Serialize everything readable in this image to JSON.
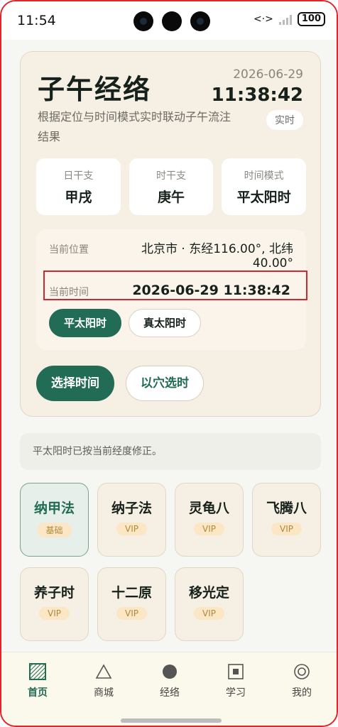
{
  "status_bar": {
    "time": "11:54",
    "battery": "100"
  },
  "header": {
    "title": "子午经络",
    "date": "2026-06-29",
    "clock": "11:38:42",
    "description": "根据定位与时间模式实时联动子午流注结果",
    "realtime_badge": "实时"
  },
  "pillars": [
    {
      "label": "日干支",
      "value": "甲戌"
    },
    {
      "label": "时干支",
      "value": "庚午"
    },
    {
      "label": "时间模式",
      "value": "平太阳时"
    }
  ],
  "location": {
    "label": "当前位置",
    "value": "北京市 · 东经116.00°, 北纬40.00°"
  },
  "current_time": {
    "label": "当前时间",
    "value": "2026-06-29 11:38:42"
  },
  "time_modes": [
    {
      "label": "平太阳时",
      "active": true
    },
    {
      "label": "真太阳时",
      "active": false
    }
  ],
  "actions": {
    "select_time": "选择时间",
    "by_acupoint": "以穴选时"
  },
  "notice": "平太阳时已按当前经度修正。",
  "methods": [
    {
      "name": "纳甲法",
      "tag": "基础",
      "active": true
    },
    {
      "name": "纳子法",
      "tag": "VIP",
      "active": false
    },
    {
      "name": "灵龟八",
      "tag": "VIP",
      "active": false
    },
    {
      "name": "飞腾八",
      "tag": "VIP",
      "active": false
    },
    {
      "name": "养子时",
      "tag": "VIP",
      "active": false
    },
    {
      "name": "十二原",
      "tag": "VIP",
      "active": false
    },
    {
      "name": "移光定",
      "tag": "VIP",
      "active": false
    }
  ],
  "bottom_nav": [
    {
      "label": "首页",
      "icon": "home-hatched-square-icon",
      "active": true
    },
    {
      "label": "商城",
      "icon": "triangle-icon",
      "active": false
    },
    {
      "label": "经络",
      "icon": "filled-circle-icon",
      "active": false
    },
    {
      "label": "学习",
      "icon": "square-in-square-icon",
      "active": false
    },
    {
      "label": "我的",
      "icon": "target-circle-icon",
      "active": false
    }
  ],
  "colors": {
    "accent": "#226b55",
    "card_bg": "#f6efe3",
    "highlight_border": "#d4262e",
    "vip_tag_bg": "#fbe7c6"
  }
}
